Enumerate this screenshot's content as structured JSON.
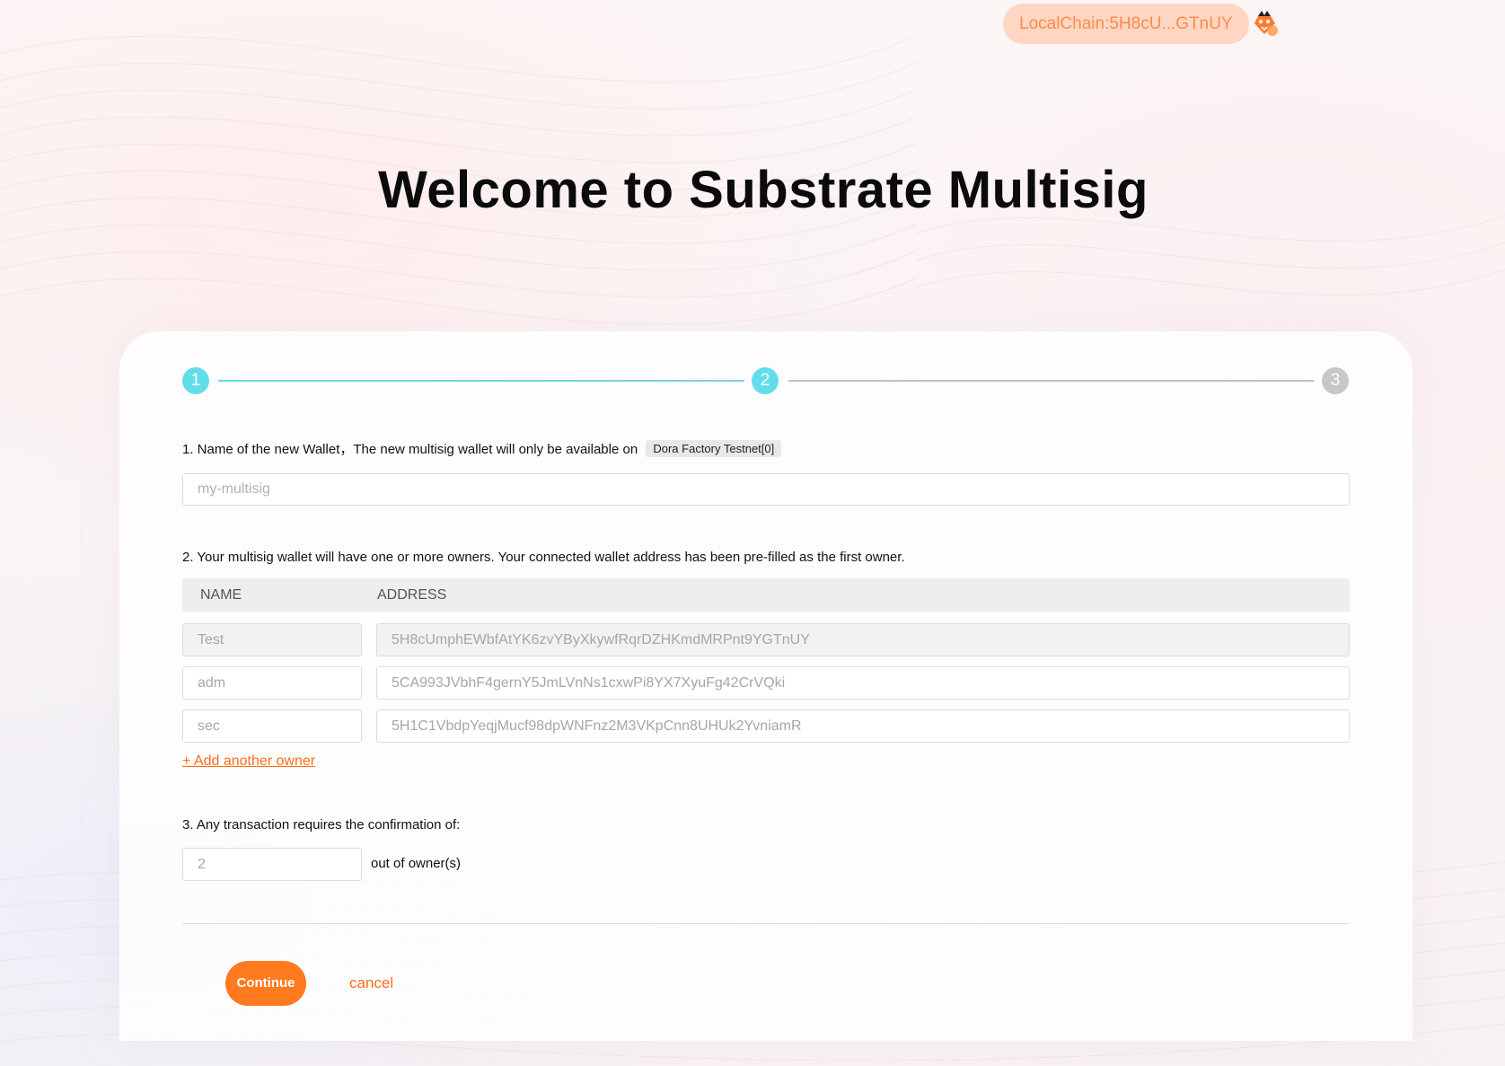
{
  "header": {
    "chain_label": "LocalChain:5H8cU...GTnUY",
    "avatar_icon": "fox-avatar-icon"
  },
  "page_title": "Welcome to Substrate Multisig",
  "stepper": {
    "steps": [
      "1",
      "2",
      "3"
    ],
    "current_step": 2
  },
  "section1": {
    "label": "1. Name of the new Wallet，The new multisig wallet will only be available on",
    "network_tag": "Dora Factory Testnet[0]",
    "wallet_name_placeholder": "my-multisig"
  },
  "section2": {
    "label": "2. Your multisig wallet will have one or more owners. Your connected wallet address has been pre-filled as the first owner.",
    "columns": {
      "name": "NAME",
      "address": "ADDRESS"
    },
    "owners": [
      {
        "name": "Test",
        "address": "5H8cUmphEWbfAtYK6zvYByXkywfRqrDZHKmdMRPnt9YGTnUY",
        "disabled": true
      },
      {
        "name": "adm",
        "address": "5CA993JVbhF4gernY5JmLVnNs1cxwPi8YX7XyuFg42CrVQki",
        "disabled": false
      },
      {
        "name": "sec",
        "address": "5H1C1VbdpYeqjMucf98dpWNFnz2M3VKpCnn8UHUk2YvniamR",
        "disabled": false
      }
    ],
    "add_owner_label": "+ Add another owner"
  },
  "section3": {
    "label": "3. Any transaction requires the confirmation of:",
    "threshold_value": "2",
    "suffix": "out of owner(s)"
  },
  "actions": {
    "continue_label": "Continue",
    "cancel_label": "cancel"
  },
  "colors": {
    "accent": "#ff7a1f",
    "step_active": "#64ddea",
    "step_inactive": "#c7c7c7",
    "chain_pill_bg": "#ffd6c2",
    "chain_pill_text": "#ff8a4c"
  }
}
